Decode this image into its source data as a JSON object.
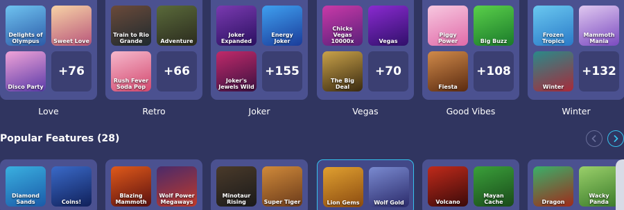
{
  "collections": [
    {
      "label": "Love",
      "more": "+76",
      "games": [
        {
          "title": "Delights of Olympus",
          "color": "#4a8ad0"
        },
        {
          "title": "Sweet Love",
          "color": "#d87aa0"
        },
        {
          "title": "Disco Party",
          "color": "#a060d0"
        }
      ]
    },
    {
      "label": "Retro",
      "more": "+66",
      "games": [
        {
          "title": "Train to Rio Grande",
          "color": "#5a3a2a"
        },
        {
          "title": "Adventure",
          "color": "#3a3a2a"
        },
        {
          "title": "Rush Fever Soda Pop",
          "color": "#e0608a"
        }
      ]
    },
    {
      "label": "Joker",
      "more": "+155",
      "games": [
        {
          "title": "Joker Expanded",
          "color": "#6a2ab0"
        },
        {
          "title": "Energy Joker",
          "color": "#3a7ad0"
        },
        {
          "title": "Joker's Jewels Wild",
          "color": "#a02a5a"
        }
      ]
    },
    {
      "label": "Vegas",
      "more": "+70",
      "games": [
        {
          "title": "Chicks Vegas 10000x",
          "color": "#b04a9a"
        },
        {
          "title": "Vegas",
          "color": "#6a2ab0"
        },
        {
          "title": "The Big Deal",
          "color": "#8a6a2a"
        }
      ]
    },
    {
      "label": "Good Vibes",
      "more": "+108",
      "games": [
        {
          "title": "Piggy Power",
          "color": "#e06aa8"
        },
        {
          "title": "Big Buzz",
          "color": "#3a9a3a"
        },
        {
          "title": "Fiesta",
          "color": "#b06a2a"
        }
      ]
    },
    {
      "label": "Winter",
      "more": "+132",
      "games": [
        {
          "title": "Frozen Tropics",
          "color": "#4a9ad0"
        },
        {
          "title": "Mammoth Mania",
          "color": "#9a6ad0"
        },
        {
          "title": "Winter",
          "color": "#2a7a7a"
        }
      ]
    }
  ],
  "popular_features": {
    "title": "Popular Features (28)",
    "prev_icon": "chevron-left-icon",
    "next_icon": "chevron-right-icon",
    "accent": "#35c3ee",
    "groups": [
      {
        "games": [
          {
            "title": "Diamond Sands"
          },
          {
            "title": "Coins!"
          }
        ]
      },
      {
        "games": [
          {
            "title": "Blazing Mammoth"
          },
          {
            "title": "Wolf Power Megaways"
          }
        ]
      },
      {
        "games": [
          {
            "title": "Minotaur Rising"
          },
          {
            "title": "Super Tiger"
          }
        ]
      },
      {
        "games": [
          {
            "title": "Lion Gems"
          },
          {
            "title": "Wolf Gold"
          }
        ],
        "selected": true
      },
      {
        "games": [
          {
            "title": "Volcano"
          },
          {
            "title": "Mayan Cache"
          }
        ]
      },
      {
        "games": [
          {
            "title": "Dragon"
          },
          {
            "title": "Wacky Panda"
          }
        ]
      }
    ]
  }
}
